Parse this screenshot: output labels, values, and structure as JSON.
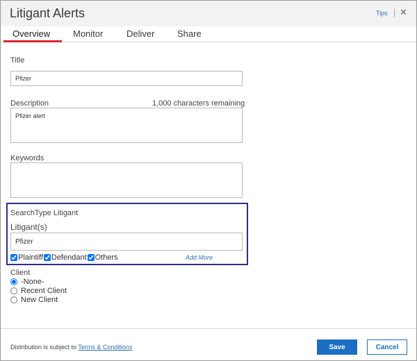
{
  "dialog": {
    "title": "Litigant Alerts",
    "tips_label": "Tips",
    "separator": "|",
    "close_glyph": "✕"
  },
  "tabs": [
    {
      "label": "Overview",
      "active": true
    },
    {
      "label": "Monitor",
      "active": false
    },
    {
      "label": "Deliver",
      "active": false
    },
    {
      "label": "Share",
      "active": false
    }
  ],
  "form": {
    "title_label": "Title",
    "title_value": "Pfizer",
    "description_label": "Description",
    "chars_remaining": "1,000 characters remaining",
    "description_value": "Pfizer alert",
    "keywords_label": "Keywords",
    "keywords_value": ""
  },
  "search": {
    "type_label": "SearchType Litigant",
    "litigants_label": "Litigant(s)",
    "litigant_value": "Pfizer",
    "checkboxes": [
      {
        "label": "Plaintiff",
        "checked": true
      },
      {
        "label": "Defendant",
        "checked": true
      },
      {
        "label": "Others",
        "checked": true
      }
    ],
    "add_more_label": "Add More"
  },
  "client": {
    "label": "Client",
    "options": [
      {
        "label": "-None-",
        "selected": true
      },
      {
        "label": "Recent Client",
        "selected": false
      },
      {
        "label": "New Client",
        "selected": false
      }
    ]
  },
  "footer": {
    "distribution_text": "Distribution is subject to ",
    "terms_link": "Terms & Conditions",
    "save_label": "Save",
    "cancel_label": "Cancel"
  },
  "colors": {
    "accent_underline": "#d8262e",
    "primary_button": "#1a6fc4",
    "search_box_border": "#2a2e8a",
    "link": "#2f6fb1"
  }
}
